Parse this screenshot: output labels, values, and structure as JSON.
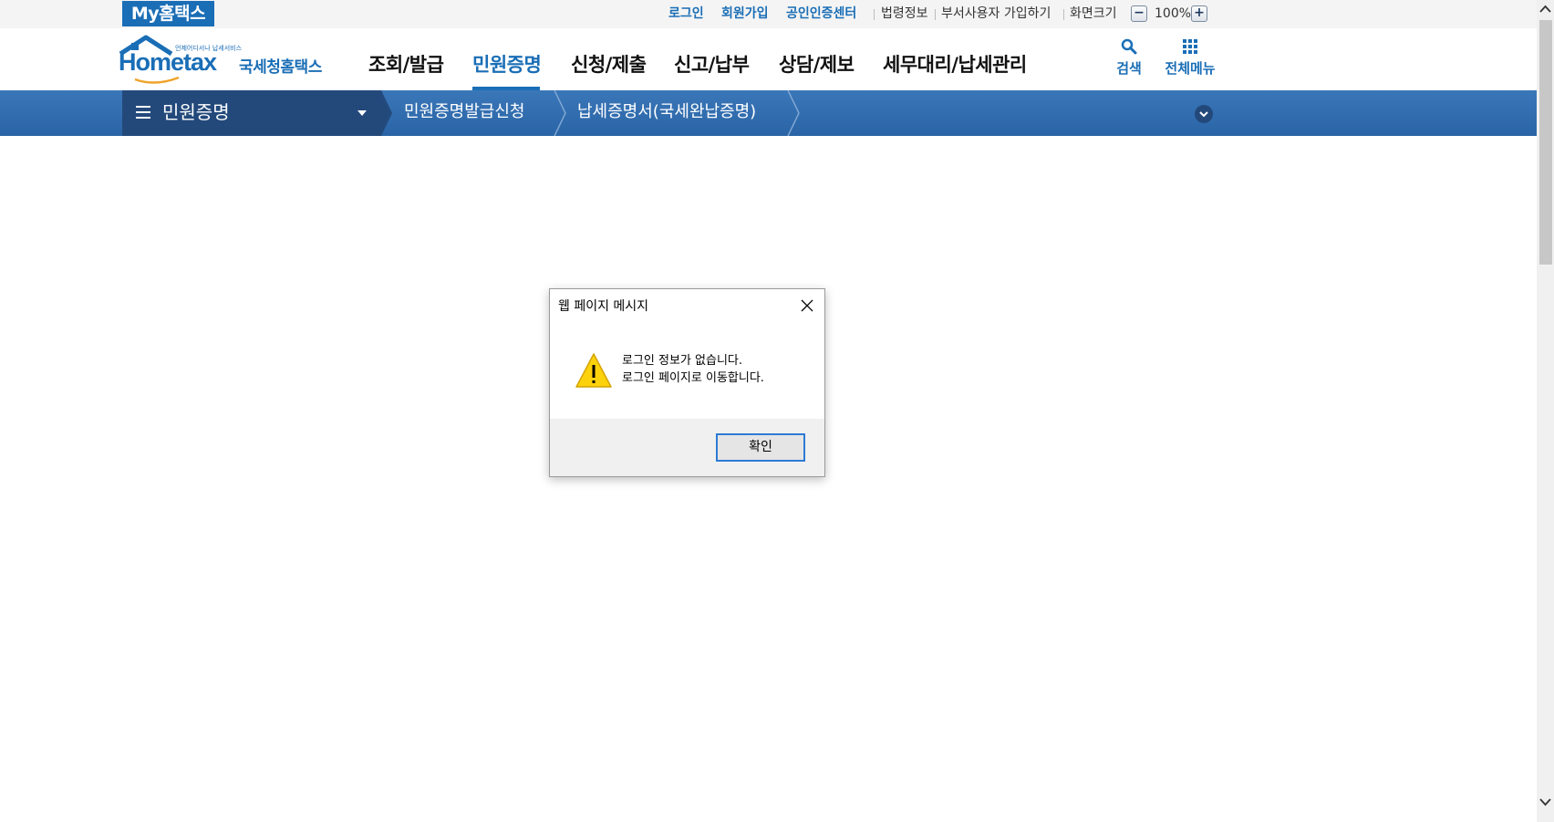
{
  "topbar": {
    "my_hometax": "My홈택스",
    "links_blue": [
      "로그인",
      "회원가입",
      "공인인증센터"
    ],
    "links_gray": [
      "법령정보",
      "부서사용자 가입하기",
      "화면크기"
    ],
    "zoom": "100%"
  },
  "header": {
    "logo_brand": "Hometax",
    "logo_name": "국세청홈택스",
    "logo_tagline": "언제어디서나 납세서비스",
    "nav": [
      "조회/발급",
      "민원증명",
      "신청/제출",
      "신고/납부",
      "상담/제보",
      "세무대리/납세관리"
    ],
    "active_nav": "민원증명",
    "search_label": "검색",
    "allmenu_label": "전체메뉴"
  },
  "breadcrumb": {
    "main": "민원증명",
    "items": [
      "민원증명발급신청",
      "납세증명서(국세완납증명)"
    ]
  },
  "dialog": {
    "title": "웹 페이지 메시지",
    "message_line1": "로그인 정보가 없습니다.",
    "message_line2": "로그인 페이지로 이동합니다.",
    "ok_label": "확인",
    "icon": "warning-icon"
  },
  "colors": {
    "brand_blue": "#1a6eb6",
    "crumb_dark": "#23497b",
    "crumb_bar": "#3570b1"
  }
}
